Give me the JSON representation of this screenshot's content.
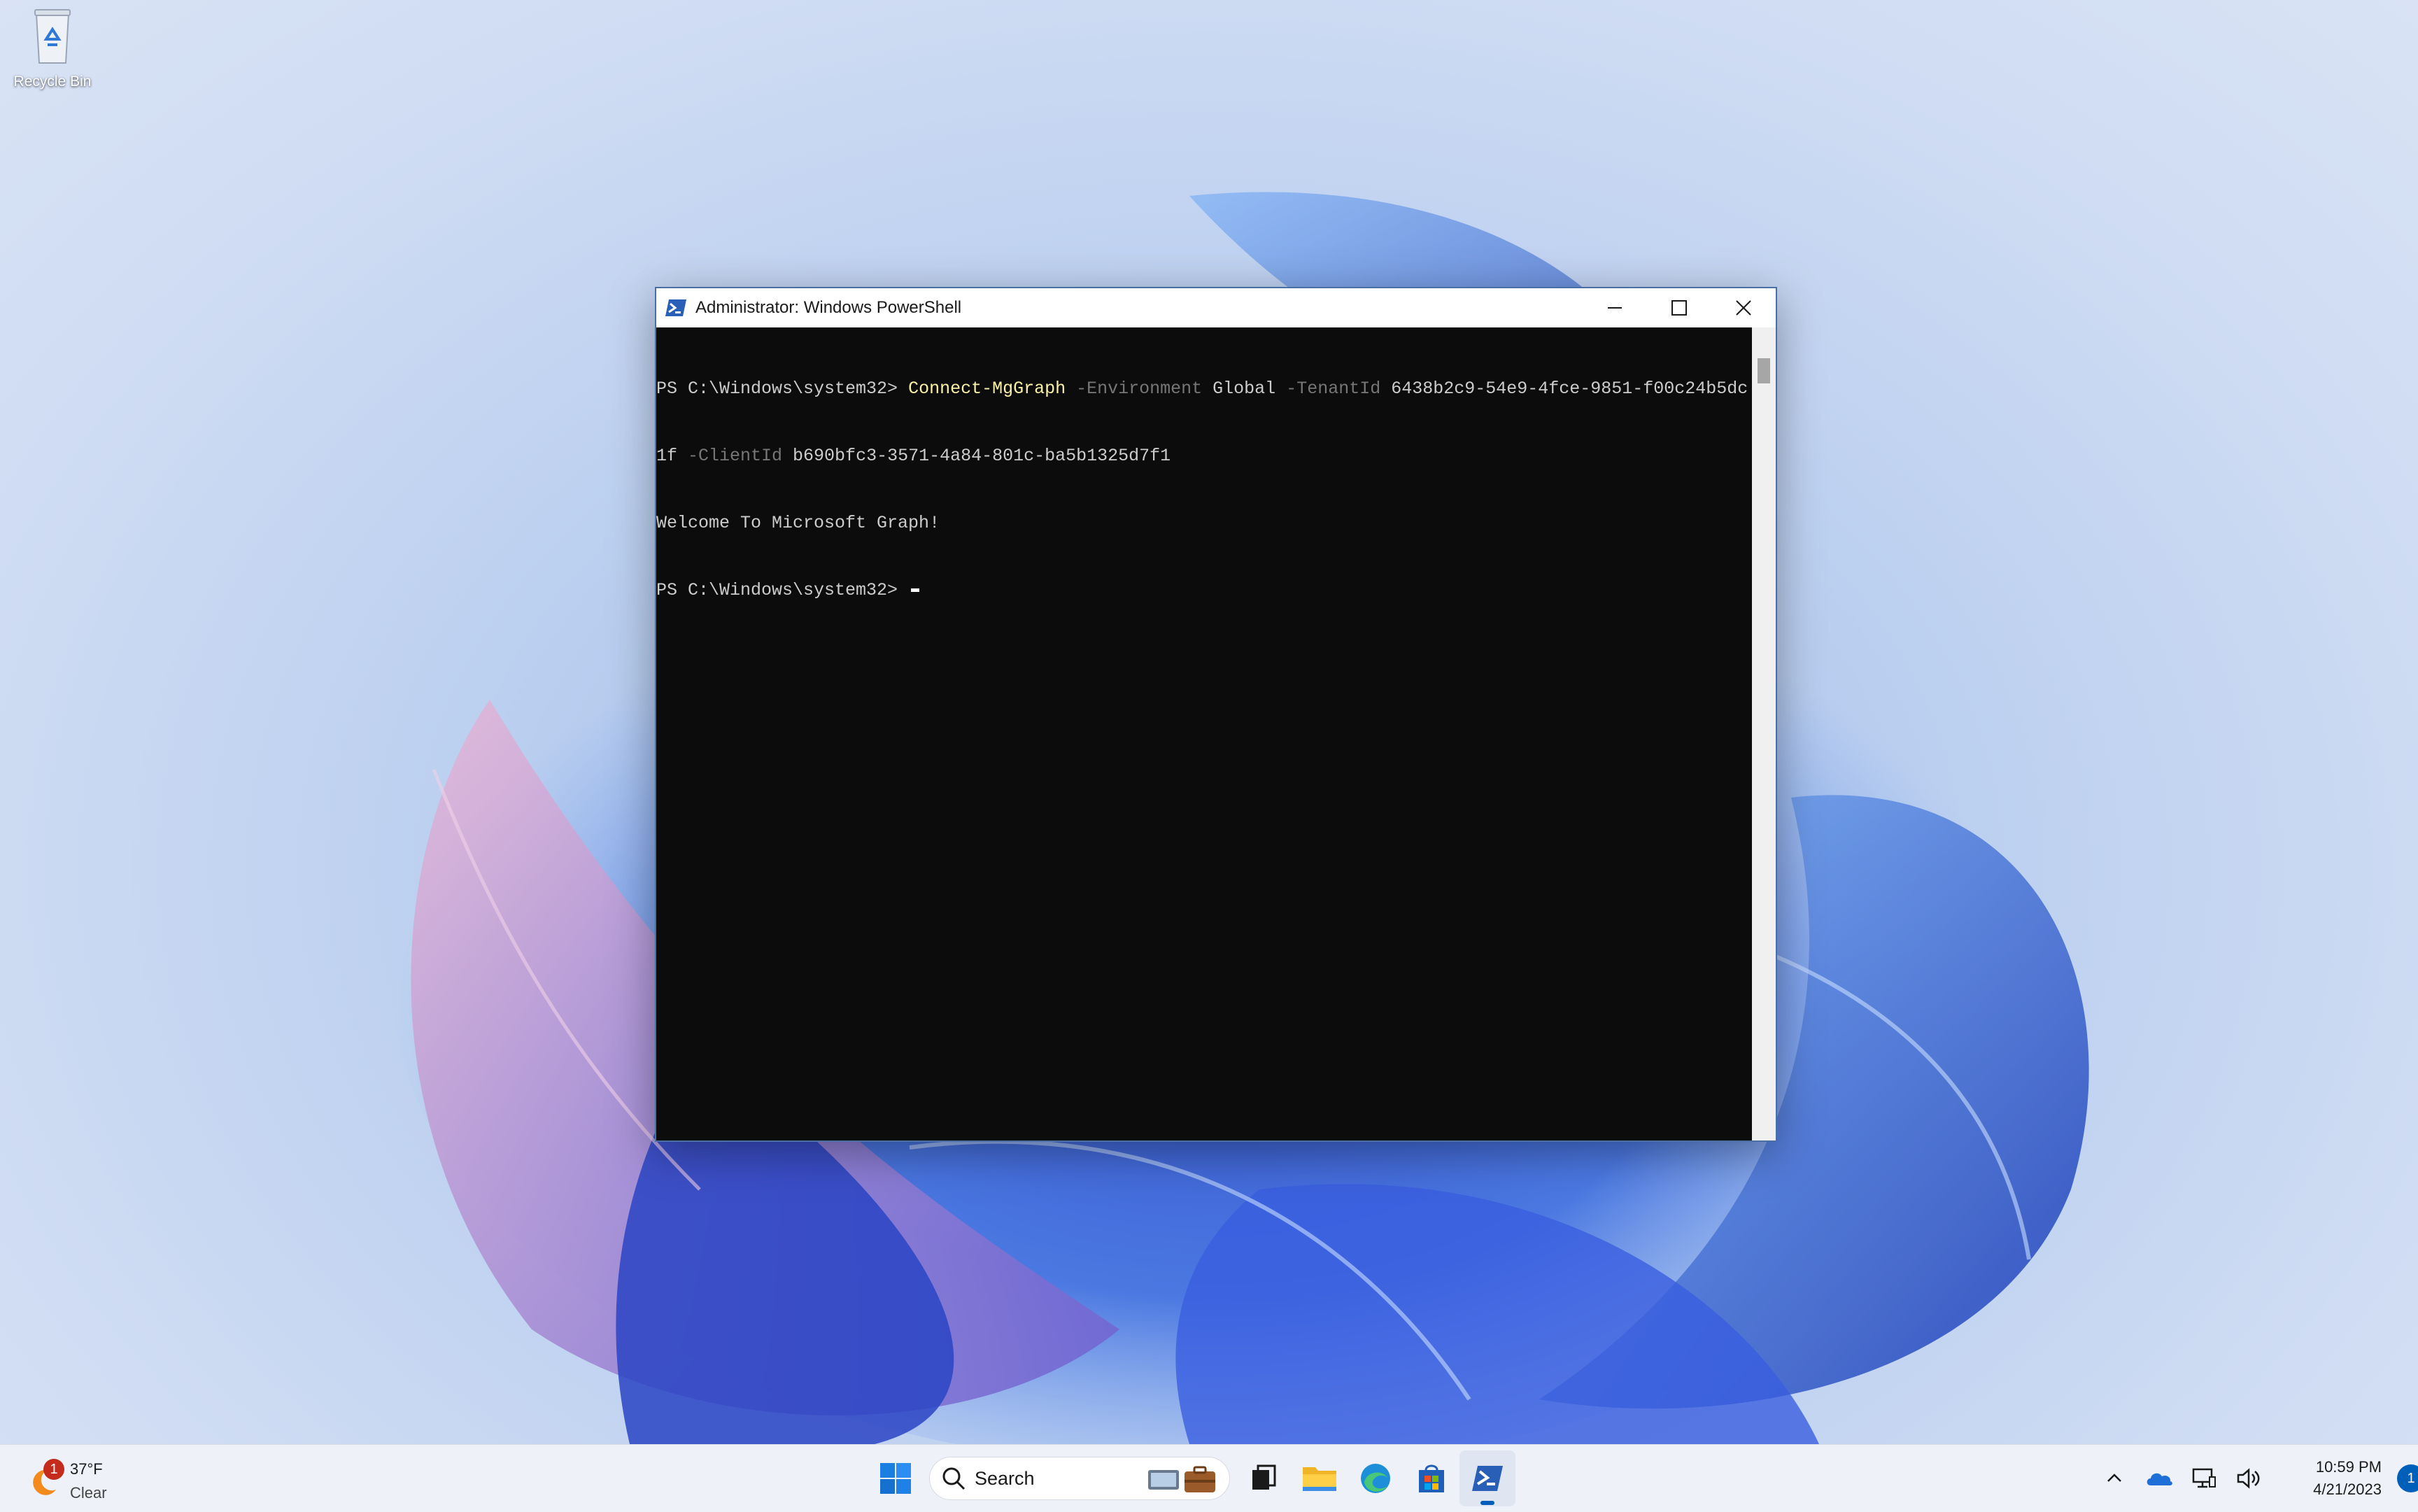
{
  "desktop": {
    "recycle_bin_label": "Recycle Bin"
  },
  "window": {
    "title": "Administrator: Windows PowerShell",
    "minimize_icon": "minimize-icon",
    "maximize_icon": "maximize-icon",
    "close_icon": "close-icon"
  },
  "console": {
    "line1": {
      "prompt": "PS C:\\Windows\\system32> ",
      "cmdlet": "Connect-MgGraph",
      "p1": " -Environment",
      "v1": " Global",
      "p2": " -TenantId",
      "v2": " 6438b2c9-54e9-4fce-9851-f00c24b5dc"
    },
    "line2": {
      "v2_cont": "1f",
      "p3": " -ClientId",
      "v3": " b690bfc3-3571-4a84-801c-ba5b1325d7f1"
    },
    "line3": "Welcome To Microsoft Graph!",
    "line4_prompt": "PS C:\\Windows\\system32> "
  },
  "taskbar": {
    "weather": {
      "badge": "1",
      "temp": "37°F",
      "condition": "Clear"
    },
    "search_label": "Search",
    "apps": [
      {
        "name": "start",
        "icon": "windows-start-icon"
      },
      {
        "name": "task-view",
        "icon": "task-view-icon"
      },
      {
        "name": "file-explorer",
        "icon": "folder-icon"
      },
      {
        "name": "edge",
        "icon": "edge-icon"
      },
      {
        "name": "store",
        "icon": "store-icon"
      },
      {
        "name": "powershell",
        "icon": "powershell-icon",
        "active": true
      }
    ],
    "clock": {
      "time": "10:59 PM",
      "date": "4/21/2023"
    },
    "notification_count": "1"
  },
  "colors": {
    "accent": "#005fb8",
    "console_bg": "#0c0c0c",
    "console_fg": "#cccccc",
    "cmdlet": "#f9f1a5",
    "param": "#767676"
  }
}
